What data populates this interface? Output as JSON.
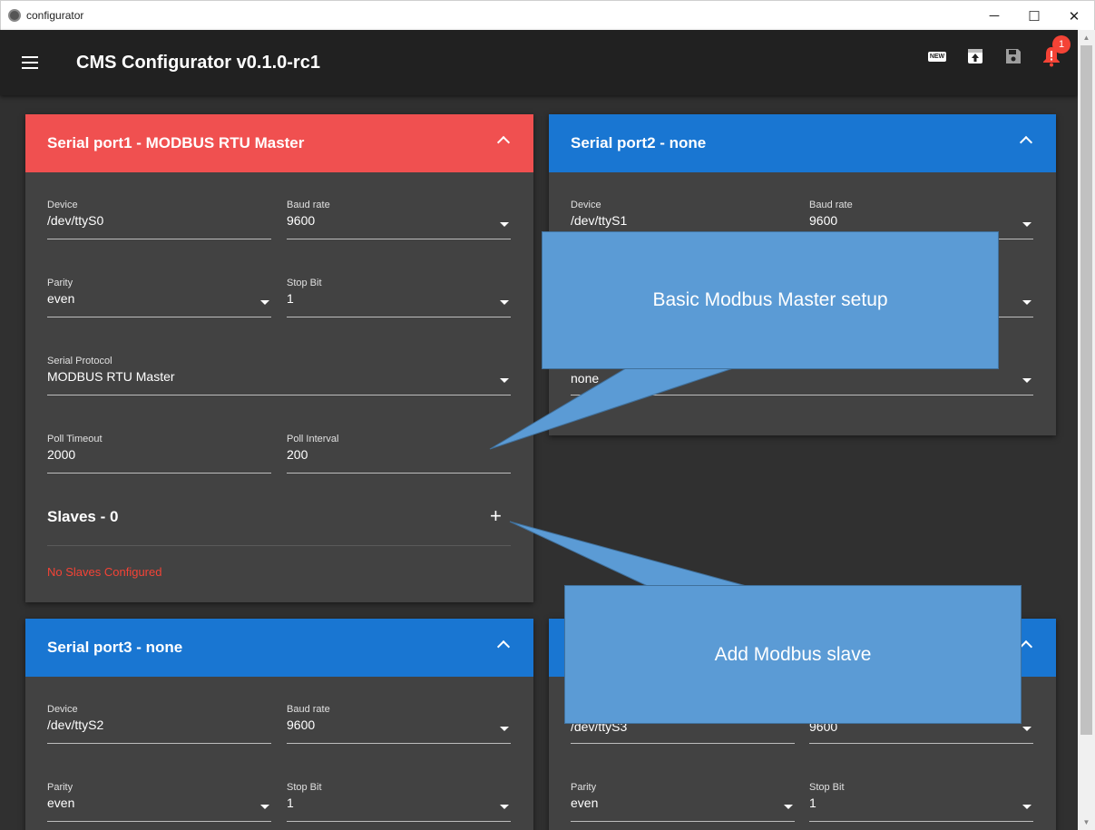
{
  "window": {
    "title": "configurator",
    "minimize": "─",
    "maximize": "☐",
    "close": "✕"
  },
  "toolbar": {
    "title": "CMS Configurator v0.1.0-rc1",
    "new_label": "NEW",
    "notification_count": "1"
  },
  "ports": [
    {
      "title": "Serial port1 - MODBUS RTU Master",
      "device_label": "Device",
      "device": "/dev/ttyS0",
      "baud_label": "Baud rate",
      "baud": "9600",
      "parity_label": "Parity",
      "parity": "even",
      "stop_label": "Stop Bit",
      "stop": "1",
      "protocol_label": "Serial Protocol",
      "protocol": "MODBUS RTU Master",
      "timeout_label": "Poll Timeout",
      "timeout": "2000",
      "interval_label": "Poll Interval",
      "interval": "200",
      "slaves_title": "Slaves - 0",
      "add_label": "+",
      "no_slaves": "No Slaves Configured"
    },
    {
      "title": "Serial port2 - none",
      "device_label": "Device",
      "device": "/dev/ttyS1",
      "baud_label": "Baud rate",
      "baud": "9600",
      "protocol": "none"
    },
    {
      "title": "Serial port3 - none",
      "device_label": "Device",
      "device": "/dev/ttyS2",
      "baud_label": "Baud rate",
      "baud": "9600",
      "parity_label": "Parity",
      "parity": "even",
      "stop_label": "Stop Bit",
      "stop": "1"
    },
    {
      "device": "/dev/ttyS3",
      "baud": "9600",
      "parity_label": "Parity",
      "parity": "even",
      "stop_label": "Stop Bit",
      "stop": "1"
    }
  ],
  "callouts": {
    "master_setup": "Basic Modbus Master setup",
    "add_slave": "Add Modbus slave"
  },
  "colors": {
    "header_red": "#f05050",
    "header_blue": "#1976d2",
    "card_bg": "#424242",
    "callout": "#5b9bd5",
    "error": "#f44336"
  }
}
